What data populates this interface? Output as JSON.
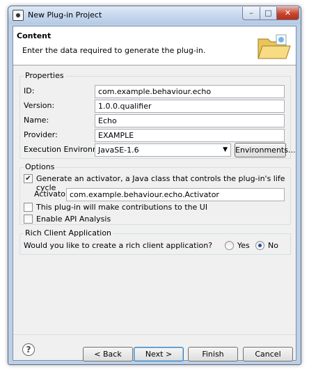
{
  "window": {
    "title": "New Plug-in Project",
    "minimize_glyph": "–",
    "maximize_glyph": "□",
    "close_glyph": "✕"
  },
  "banner": {
    "title": "Content",
    "message": "Enter the data required to generate the plug-in.",
    "icon": "open-folder-icon"
  },
  "properties": {
    "group_title": "Properties",
    "id_label": "ID:",
    "id_value": "com.example.behaviour.echo",
    "version_label": "Version:",
    "version_value": "1.0.0.qualifier",
    "name_label": "Name:",
    "name_value": "Echo",
    "provider_label": "Provider:",
    "provider_value": "EXAMPLE",
    "exec_env_label": "Execution Environment:",
    "exec_env_value": "JavaSE-1.6",
    "environments_button": "Environments..."
  },
  "options": {
    "group_title": "Options",
    "generate_activator_label": "Generate an activator, a Java class that controls the plug-in's life cycle",
    "generate_activator_checked": true,
    "activator_label": "Activator:",
    "activator_value": "com.example.behaviour.echo.Activator",
    "ui_contrib_label": "This plug-in will make contributions to the UI",
    "ui_contrib_checked": false,
    "api_analysis_label": "Enable API Analysis",
    "api_analysis_checked": false
  },
  "rca": {
    "group_title": "Rich Client Application",
    "question": "Would you like to create a rich client application?",
    "yes_label": "Yes",
    "no_label": "No",
    "selected": "No"
  },
  "footer": {
    "help_glyph": "?",
    "back_button": "< Back",
    "next_button": "Next >",
    "finish_button": "Finish",
    "cancel_button": "Cancel"
  },
  "colors": {
    "title_bar": "#c3d5ec",
    "close_button": "#c7442e",
    "dialog_bg": "#f0f0f0",
    "default_button_border": "#3c7fb1"
  }
}
